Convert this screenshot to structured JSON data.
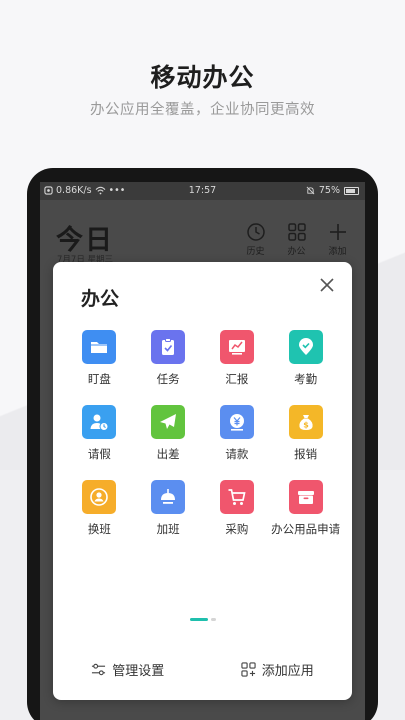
{
  "promo": {
    "headline": "移动办公",
    "subline": "办公应用全覆盖，企业协同更高效"
  },
  "status_bar": {
    "speed": "0.86K/s",
    "dots": "•••",
    "time": "17:57",
    "battery": "75%"
  },
  "home": {
    "title": "今日",
    "date": "7月7日 星期三",
    "actions": [
      {
        "label": "历史",
        "icon": "clock-icon"
      },
      {
        "label": "办公",
        "icon": "grid-icon"
      },
      {
        "label": "添加",
        "icon": "plus-icon"
      }
    ]
  },
  "modal": {
    "title": "办公",
    "apps": [
      {
        "label": "盯盘",
        "icon": "folder-icon",
        "color": "#3f8ef2"
      },
      {
        "label": "任务",
        "icon": "clipboard-check-icon",
        "color": "#6a73ee"
      },
      {
        "label": "汇报",
        "icon": "chart-icon",
        "color": "#f0566d"
      },
      {
        "label": "考勤",
        "icon": "location-check-icon",
        "color": "#1fc3b0"
      },
      {
        "label": "请假",
        "icon": "user-clock-icon",
        "color": "#3aa0f0"
      },
      {
        "label": "出差",
        "icon": "airplane-icon",
        "color": "#62c43e"
      },
      {
        "label": "请款",
        "icon": "yen-icon",
        "color": "#5b8ef0"
      },
      {
        "label": "报销",
        "icon": "money-bag-icon",
        "color": "#f4b728"
      },
      {
        "label": "换班",
        "icon": "user-swap-icon",
        "color": "#f6ad2a"
      },
      {
        "label": "加班",
        "icon": "lamp-icon",
        "color": "#5b8ef0"
      },
      {
        "label": "采购",
        "icon": "cart-icon",
        "color": "#f0566d"
      },
      {
        "label": "办公用品申请",
        "icon": "box-icon",
        "color": "#f0566d"
      }
    ],
    "manage_label": "管理设置",
    "add_label": "添加应用"
  },
  "colors": {
    "accent": "#1fbfad"
  }
}
